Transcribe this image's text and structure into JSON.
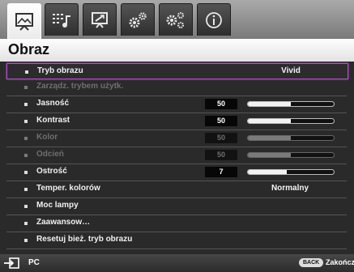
{
  "tabs": [
    {
      "name": "picture-tab",
      "icon": "picture-icon",
      "active": true
    },
    {
      "name": "picture-advanced-tab",
      "icon": "sliders-note-icon",
      "active": false
    },
    {
      "name": "display-tab",
      "icon": "screen-adjust-icon",
      "active": false
    },
    {
      "name": "settings-tab",
      "icon": "gears-icon",
      "active": false
    },
    {
      "name": "system-tab",
      "icon": "gears-plus-icon",
      "active": false
    },
    {
      "name": "information-tab",
      "icon": "info-icon",
      "active": false
    }
  ],
  "header": {
    "title": "Obraz"
  },
  "menu": {
    "items": [
      {
        "label": "Tryb obrazu",
        "type": "text",
        "value": "Vivid",
        "selected": true,
        "disabled": false
      },
      {
        "label": "Zarządz. trybem użytk.",
        "type": "none",
        "disabled": true
      },
      {
        "label": "Jasność",
        "type": "slider",
        "value": "50",
        "level": 0.5,
        "disabled": false
      },
      {
        "label": "Kontrast",
        "type": "slider",
        "value": "50",
        "level": 0.5,
        "disabled": false
      },
      {
        "label": "Kolor",
        "type": "slider",
        "value": "50",
        "level": 0.5,
        "disabled": true
      },
      {
        "label": "Odcień",
        "type": "slider",
        "value": "50",
        "level": 0.5,
        "disabled": true
      },
      {
        "label": "Ostrość",
        "type": "slider",
        "value": "7",
        "level": 0.45,
        "disabled": false
      },
      {
        "label": "Temper. kolorów",
        "type": "text",
        "value": "Normalny",
        "disabled": false
      },
      {
        "label": "Moc lampy",
        "type": "none",
        "disabled": false
      },
      {
        "label": "Zaawansow…",
        "type": "none",
        "disabled": false
      },
      {
        "label": "Resetuj bież. tryb obrazu",
        "type": "none",
        "disabled": false
      }
    ]
  },
  "footer": {
    "source_icon": "input-source-icon",
    "source_label": "PC",
    "back_button": "BACK",
    "exit_label": "Zakończ"
  },
  "colors": {
    "selection": "#b54fc8",
    "panel": "#2a2a2a",
    "topbar": "#8e8e8e"
  }
}
